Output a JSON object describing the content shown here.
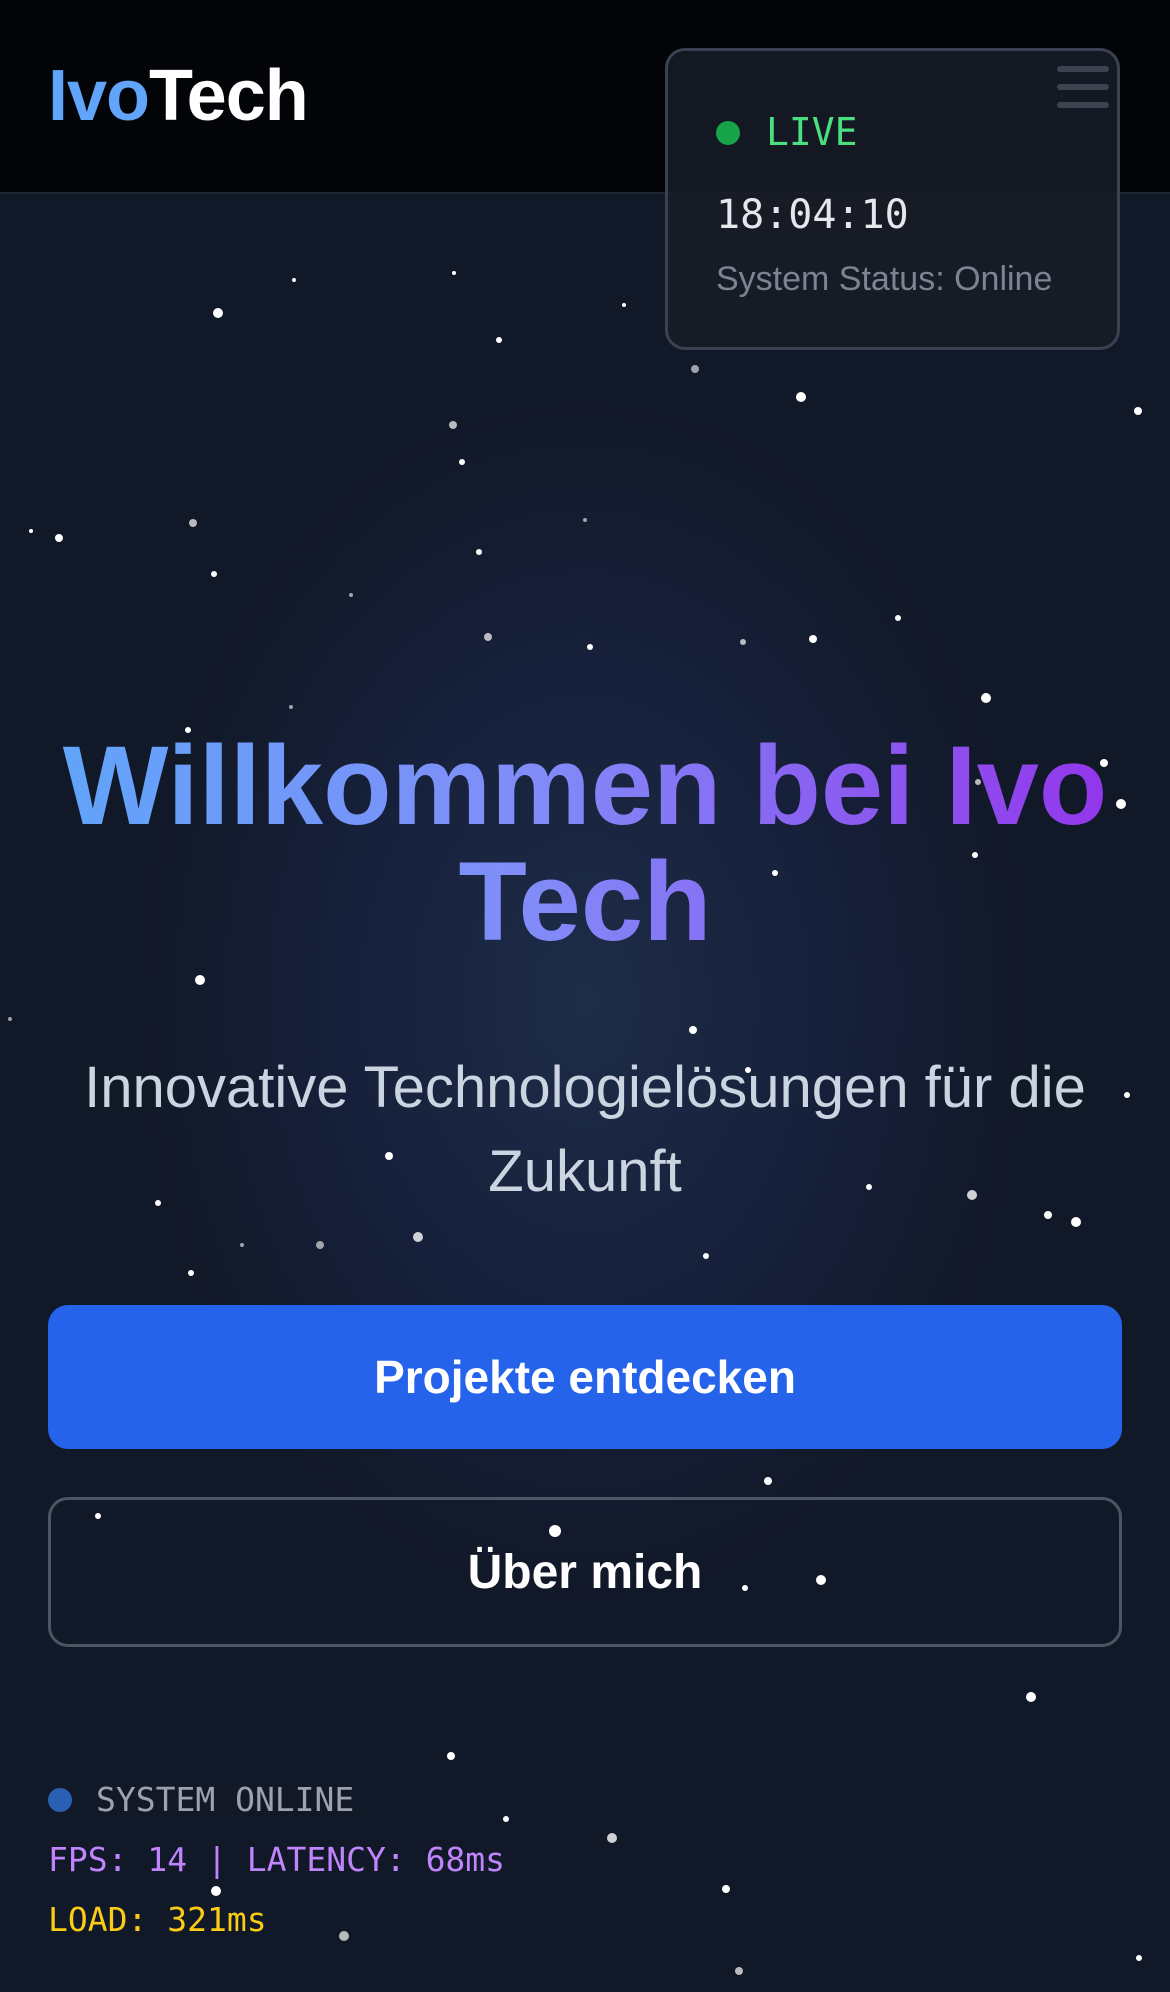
{
  "header": {
    "logo_part1": "Ivo",
    "logo_part2": "Tech",
    "menu_icon": "hamburger-menu-icon"
  },
  "status_card": {
    "live_label": "LIVE",
    "time": "18:04:10",
    "system_status": "System Status: Online"
  },
  "hero": {
    "title": "Willkommen bei Ivo Tech",
    "subtitle": "Innovative Technologielösungen für die Zukunft",
    "primary_button": "Projekte entdecken",
    "secondary_button": "Über mich"
  },
  "footer_status": {
    "online_label": "SYSTEM ONLINE",
    "fps_label": "FPS:",
    "fps_value": "14",
    "separator": "|",
    "latency_label": "LATENCY:",
    "latency_value": "68ms",
    "load_label": "LOAD:",
    "load_value": "321ms"
  },
  "colors": {
    "accent_blue": "#60a5fa",
    "primary_button": "#2563eb",
    "live_green": "#4ade80",
    "perf_purple": "#c084fc",
    "load_yellow": "#facc15",
    "title_gradient_start": "#60a5fa",
    "title_gradient_end": "#9333ea"
  }
}
